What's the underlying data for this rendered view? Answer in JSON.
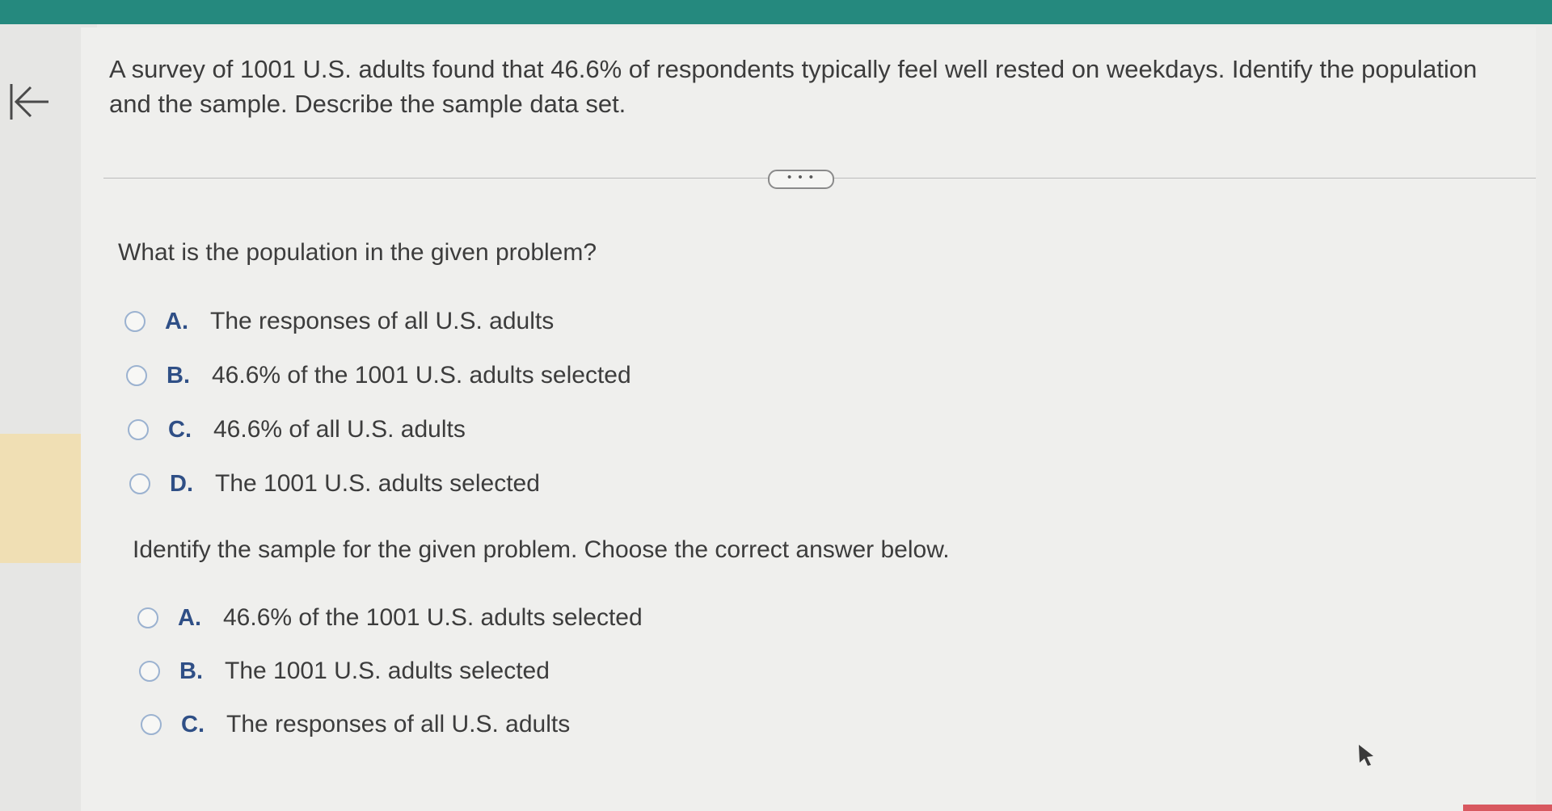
{
  "question": {
    "text": "A survey of 1001 U.S. adults found that 46.6% of respondents typically feel well rested on weekdays. Identify the population and the sample. Describe the sample data set."
  },
  "more_button": {
    "label": "• • •"
  },
  "part1": {
    "prompt": "What is the population in the given problem?",
    "options": [
      {
        "letter": "A.",
        "text": "The responses of all U.S. adults"
      },
      {
        "letter": "B.",
        "text": "46.6% of the 1001 U.S. adults selected"
      },
      {
        "letter": "C.",
        "text": "46.6% of all U.S. adults"
      },
      {
        "letter": "D.",
        "text": "The 1001 U.S. adults selected"
      }
    ]
  },
  "part2": {
    "prompt": "Identify the sample for the given problem. Choose the correct answer below.",
    "options": [
      {
        "letter": "A.",
        "text": "46.6% of the 1001 U.S. adults selected"
      },
      {
        "letter": "B.",
        "text": "The 1001 U.S. adults selected"
      },
      {
        "letter": "C.",
        "text": "The responses of all U.S. adults"
      }
    ]
  },
  "colors": {
    "top_bar": "#25897e",
    "option_letter": "#2f4f86",
    "radio_border": "#9bb2d0",
    "rail_highlight": "#f0dfb4"
  },
  "icons": {
    "back": "back-to-start-icon",
    "cursor": "mouse-cursor-icon"
  }
}
